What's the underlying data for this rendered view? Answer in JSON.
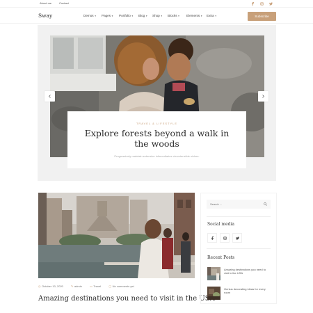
{
  "topbar": {
    "links": [
      "About me",
      "Contact"
    ],
    "social_icons": [
      "facebook-icon",
      "instagram-icon",
      "twitter-icon"
    ]
  },
  "header": {
    "logo": "Sway",
    "nav": [
      "Demos",
      "Pages",
      "Portfolio",
      "Blog",
      "Shop",
      "Blocks",
      "Elements",
      "Extra"
    ],
    "subscribe_label": "Subscribe"
  },
  "hero": {
    "category": "TRAVEL & LIFESTYLE",
    "title": "Explore forests beyond a walk in the woods",
    "subtitle": "Progressively maintain extensive infomediaries via extensible niches.",
    "prev_icon": "chevron-left-icon",
    "next_icon": "chevron-right-icon"
  },
  "post": {
    "date": "October 10, 2020",
    "author": "admin",
    "category": "Travel",
    "comments": "No comments yet",
    "title": "Amazing destinations you need to visit in the USA"
  },
  "sidebar": {
    "search_placeholder": "Search ...",
    "social_title": "Social media",
    "recent_title": "Recent Posts",
    "recent_posts": [
      "Amazing destinations you need to visit in the USA",
      "Genius decorating ideas for every room"
    ]
  },
  "colors": {
    "accent": "#c8a07a",
    "hero_background": "#f1f1f1",
    "text_dark": "#2b2b2b"
  }
}
